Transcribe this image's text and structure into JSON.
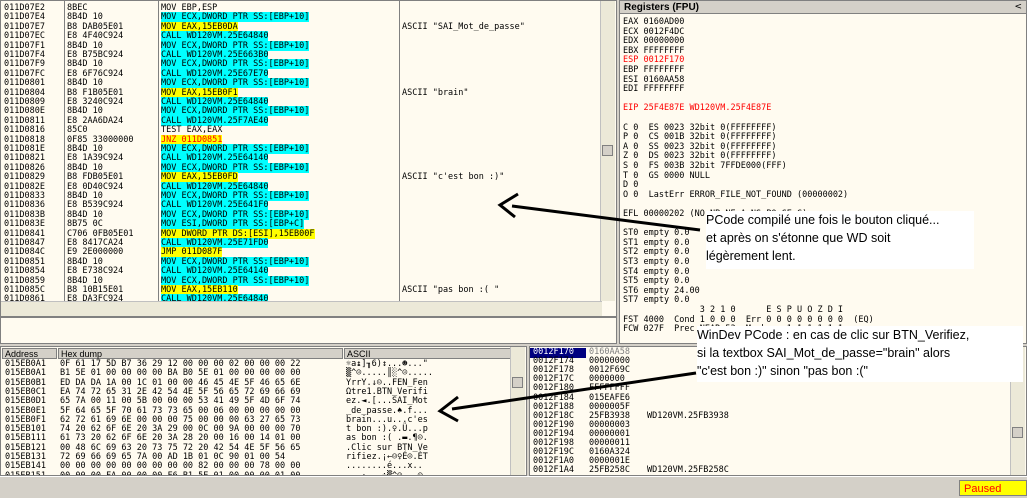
{
  "registers_title": "Registers (FPU)",
  "status": "Paused",
  "cpu_rows": [
    {
      "addr": "011D07E2",
      "hex": "8BEC",
      "ins": "MOV EBP,ESP",
      "cmt": "",
      "hl": ""
    },
    {
      "addr": "011D07E4",
      "hex": "8B4D 10",
      "ins": "MOV ECX,DWORD PTR SS:[EBP+10]",
      "cmt": "",
      "hl": "cyan"
    },
    {
      "addr": "011D07E7",
      "hex": "B8 DAB05E01",
      "ins": "MOV EAX,15EB0DA",
      "cmt": "ASCII \"SAI_Mot_de_passe\"",
      "hl": "yellow"
    },
    {
      "addr": "011D07EC",
      "hex": "E8 4F40C924",
      "ins": "CALL WD120VM.25E64840",
      "cmt": "",
      "hl": "cyan"
    },
    {
      "addr": "011D07F1",
      "hex": "8B4D 10",
      "ins": "MOV ECX,DWORD PTR SS:[EBP+10]",
      "cmt": "",
      "hl": "cyan"
    },
    {
      "addr": "011D07F4",
      "hex": "E8 B75BC924",
      "ins": "CALL WD120VM.25E663B0",
      "cmt": "",
      "hl": "cyan"
    },
    {
      "addr": "011D07F9",
      "hex": "8B4D 10",
      "ins": "MOV ECX,DWORD PTR SS:[EBP+10]",
      "cmt": "",
      "hl": "cyan"
    },
    {
      "addr": "011D07FC",
      "hex": "E8 6F76C924",
      "ins": "CALL WD120VM.25E67E70",
      "cmt": "",
      "hl": "cyan"
    },
    {
      "addr": "011D0801",
      "hex": "8B4D 10",
      "ins": "MOV ECX,DWORD PTR SS:[EBP+10]",
      "cmt": "",
      "hl": "cyan"
    },
    {
      "addr": "011D0804",
      "hex": "B8 F1B05E01",
      "ins": "MOV EAX,15EB0F1",
      "cmt": "ASCII \"brain\"",
      "hl": "yellow"
    },
    {
      "addr": "011D0809",
      "hex": "E8 3240C924",
      "ins": "CALL WD120VM.25E64840",
      "cmt": "",
      "hl": "cyan"
    },
    {
      "addr": "011D080E",
      "hex": "8B4D 10",
      "ins": "MOV ECX,DWORD PTR SS:[EBP+10]",
      "cmt": "",
      "hl": "cyan"
    },
    {
      "addr": "011D0811",
      "hex": "E8 2AA6DA24",
      "ins": "CALL WD120VM.25F7AE40",
      "cmt": "",
      "hl": "cyan"
    },
    {
      "addr": "011D0816",
      "hex": "85C0",
      "ins": "TEST EAX,EAX",
      "cmt": "",
      "hl": ""
    },
    {
      "addr": "011D0818",
      "hex": "0F85 33000000",
      "ins": "JNZ 011D0851",
      "cmt": "",
      "hl": "red"
    },
    {
      "addr": "011D081E",
      "hex": "8B4D 10",
      "ins": "MOV ECX,DWORD PTR SS:[EBP+10]",
      "cmt": "",
      "hl": "cyan"
    },
    {
      "addr": "011D0821",
      "hex": "E8 1A39C924",
      "ins": "CALL WD120VM.25E64140",
      "cmt": "",
      "hl": "cyan"
    },
    {
      "addr": "011D0826",
      "hex": "8B4D 10",
      "ins": "MOV ECX,DWORD PTR SS:[EBP+10]",
      "cmt": "",
      "hl": "cyan"
    },
    {
      "addr": "011D0829",
      "hex": "B8 FDB05E01",
      "ins": "MOV EAX,15EB0FD",
      "cmt": "ASCII \"c'est bon :)\"",
      "hl": "yellow"
    },
    {
      "addr": "011D082E",
      "hex": "E8 0D40C924",
      "ins": "CALL WD120VM.25E64840",
      "cmt": "",
      "hl": "cyan"
    },
    {
      "addr": "011D0833",
      "hex": "8B4D 10",
      "ins": "MOV ECX,DWORD PTR SS:[EBP+10]",
      "cmt": "",
      "hl": "cyan"
    },
    {
      "addr": "011D0836",
      "hex": "E8 B539C924",
      "ins": "CALL WD120VM.25E641F0",
      "cmt": "",
      "hl": "cyan"
    },
    {
      "addr": "011D083B",
      "hex": "8B4D 10",
      "ins": "MOV ECX,DWORD PTR SS:[EBP+10]",
      "cmt": "",
      "hl": "cyan"
    },
    {
      "addr": "011D083E",
      "hex": "8B75 0C",
      "ins": "MOV ESI,DWORD PTR SS:[EBP+C]",
      "cmt": "",
      "hl": "cyan"
    },
    {
      "addr": "011D0841",
      "hex": "C706 0FB05E01",
      "ins": "MOV DWORD PTR DS:[ESI],15EB00F",
      "cmt": "",
      "hl": "yellow"
    },
    {
      "addr": "011D0847",
      "hex": "E8 8417CA24",
      "ins": "CALL WD120VM.25E71FD0",
      "cmt": "",
      "hl": "cyan"
    },
    {
      "addr": "011D084C",
      "hex": "E9 2E000000",
      "ins": "JMP 011D087F",
      "cmt": "",
      "hl": "yellow"
    },
    {
      "addr": "011D0851",
      "hex": "8B4D 10",
      "ins": "MOV ECX,DWORD PTR SS:[EBP+10]",
      "cmt": "",
      "hl": "cyan"
    },
    {
      "addr": "011D0854",
      "hex": "E8 E738C924",
      "ins": "CALL WD120VM.25E64140",
      "cmt": "",
      "hl": "cyan"
    },
    {
      "addr": "011D0859",
      "hex": "8B4D 10",
      "ins": "MOV ECX,DWORD PTR SS:[EBP+10]",
      "cmt": "",
      "hl": "cyan"
    },
    {
      "addr": "011D085C",
      "hex": "B8 10B15E01",
      "ins": "MOV EAX,15EB110",
      "cmt": "ASCII \"pas bon :( \"",
      "hl": "yellow"
    },
    {
      "addr": "011D0861",
      "hex": "E8 DA3FC924",
      "ins": "CALL WD120VM.25E64840",
      "cmt": "",
      "hl": "cyan"
    },
    {
      "addr": "011D0866",
      "hex": "8B4D 10",
      "ins": "MOV ECX,DWORD PTR SS:[EBP+10]",
      "cmt": "",
      "hl": "cyan"
    },
    {
      "addr": "011D0869",
      "hex": "E8 3339C924",
      "ins": "CALL WD120VM.25E641F0",
      "cmt": "",
      "hl": "cyan"
    }
  ],
  "registers": [
    {
      "t": "EAX 0160AD00",
      "c": ""
    },
    {
      "t": "ECX 0012F4DC",
      "c": ""
    },
    {
      "t": "EDX 00000000",
      "c": ""
    },
    {
      "t": "EBX FFFFFFFF",
      "c": ""
    },
    {
      "t": "ESP 0012F170",
      "c": "red"
    },
    {
      "t": "EBP FFFFFFFF",
      "c": ""
    },
    {
      "t": "ESI 0160AA58",
      "c": ""
    },
    {
      "t": "EDI FFFFFFFF",
      "c": ""
    },
    {
      "t": "",
      "c": ""
    },
    {
      "t": "EIP 25F4E87E WD120VM.25F4E87E",
      "c": "red"
    },
    {
      "t": "",
      "c": ""
    },
    {
      "t": "C 0  ES 0023 32bit 0(FFFFFFFF)",
      "c": ""
    },
    {
      "t": "P 0  CS 001B 32bit 0(FFFFFFFF)",
      "c": ""
    },
    {
      "t": "A 0  SS 0023 32bit 0(FFFFFFFF)",
      "c": ""
    },
    {
      "t": "Z 0  DS 0023 32bit 0(FFFFFFFF)",
      "c": ""
    },
    {
      "t": "S 0  FS 003B 32bit 7FFDE000(FFF)",
      "c": ""
    },
    {
      "t": "T 0  GS 0000 NULL",
      "c": ""
    },
    {
      "t": "D 0",
      "c": ""
    },
    {
      "t": "O 0  LastErr ERROR_FILE_NOT_FOUND (00000002)",
      "c": ""
    },
    {
      "t": "",
      "c": ""
    },
    {
      "t": "EFL 00000202 (NO,NB,NE,A,NS,PO,GE,G)",
      "c": ""
    },
    {
      "t": "",
      "c": ""
    },
    {
      "t": "ST0 empty 0.0",
      "c": ""
    },
    {
      "t": "ST1 empty 0.0",
      "c": ""
    },
    {
      "t": "ST2 empty 0.0",
      "c": ""
    },
    {
      "t": "ST3 empty 0.0",
      "c": ""
    },
    {
      "t": "ST4 empty 0.0",
      "c": ""
    },
    {
      "t": "ST5 empty 0.0",
      "c": ""
    },
    {
      "t": "ST6 empty 24.00",
      "c": ""
    },
    {
      "t": "ST7 empty 0.0",
      "c": ""
    },
    {
      "t": "               3 2 1 0      E S P U O Z D I",
      "c": ""
    },
    {
      "t": "FST 4000  Cond 1 0 0 0  Err 0 0 0 0 0 0 0 0  (EQ)",
      "c": ""
    },
    {
      "t": "FCW 027F  Prec NEAR,53  Mask    1 1 1 1 1 1",
      "c": ""
    }
  ],
  "dump": {
    "headers": {
      "addr": "Address",
      "hex": "Hex dump",
      "ascii": "ASCII"
    },
    "rows": [
      {
        "addr": "015EB0A1",
        "hex": "0F 61 17 5D B7 36 29 12 00 00 00 02 00 00 00 22",
        "asc": "☼a↨]╖6)↕...☻...\""
      },
      {
        "addr": "015EB0A1",
        "hex": "B1 5E 01 00 00 00 00 BA B0 5E 01 00 00 00 00 00",
        "asc": "▒^☺.....║░^☺....."
      },
      {
        "addr": "015EB0B1",
        "hex": "ED DA DA 1A 00 1C 01 00 00 46 45 4E 5F 46 65 6E",
        "asc": "ΥrrΥ.↓☺..FEN_Fen"
      },
      {
        "addr": "015EB0C1",
        "hex": "EA 74 72 65 31 2E 42 54 4E 5F 56 65 72 69 66 69",
        "asc": "Ωtre1.BTN_Verifi"
      },
      {
        "addr": "015EB0D1",
        "hex": "65 7A 00 11 00 5B 00 00 00 53 41 49 5F 4D 6F 74",
        "asc": "ez.◄.[...SAI_Mot"
      },
      {
        "addr": "015EB0E1",
        "hex": "5F 64 65 5F 70 61 73 73 65 00 06 00 00 00 00 00",
        "asc": "_de_passe.♠.f..."
      },
      {
        "addr": "015EB0F1",
        "hex": "62 72 61 69 6E 00 00 00 75 00 00 00 63 27 65 73",
        "asc": "brain...u...c'es"
      },
      {
        "addr": "015EB101",
        "hex": "74 20 62 6F 6E 20 3A 29 00 0C 00 9A 00 00 00 70",
        "asc": "t bon :).♀.Ü...p"
      },
      {
        "addr": "015EB111",
        "hex": "61 73 20 62 6F 6E 20 3A 28 20 00 16 00 14 01 00",
        "asc": "as bon :( .▬.¶☺."
      },
      {
        "addr": "015EB121",
        "hex": "00 48 6C 69 63 20 73 75 72 20 42 54 4E 5F 56 65",
        "asc": ".Clic sur BTN_Ve"
      },
      {
        "addr": "015EB131",
        "hex": "72 69 66 69 65 7A 00 AD 1B 01 0C 90 01 00 54",
        "asc": "rifiez.¡←☺♀É☺.ÈT"
      },
      {
        "addr": "015EB141",
        "hex": "00 00 00 00 00 00 00 00 00 82 00 00 00 78 00 00",
        "asc": "........é...x.."
      },
      {
        "addr": "015EB151",
        "hex": "00 00 00 FA 00 00 00 F6 B1 5E 01 00 00 00 01 00",
        "asc": "...·...÷▒^☺...☺."
      }
    ]
  },
  "stack_rows": [
    {
      "addr": "0012F170",
      "val": "0160AA58",
      "cmt": "",
      "sel": true
    },
    {
      "addr": "0012F174",
      "val": "00000000",
      "cmt": "",
      "sel": false
    },
    {
      "addr": "0012F178",
      "val": "0012F69C",
      "cmt": "",
      "sel": false
    },
    {
      "addr": "0012F17C",
      "val": "0000000",
      "cmt": "",
      "sel": false
    },
    {
      "addr": "0012F180",
      "val": "FFFFFFFF",
      "cmt": "",
      "sel": false
    },
    {
      "addr": "0012F184",
      "val": "015EAFE6",
      "cmt": "",
      "sel": false
    },
    {
      "addr": "0012F188",
      "val": "0000005F",
      "cmt": "",
      "sel": false
    },
    {
      "addr": "0012F18C",
      "val": "25FB3938",
      "cmt": "WD120VM.25FB3938",
      "sel": false
    },
    {
      "addr": "0012F190",
      "val": "00000003",
      "cmt": "",
      "sel": false
    },
    {
      "addr": "0012F194",
      "val": "00000001",
      "cmt": "",
      "sel": false
    },
    {
      "addr": "0012F198",
      "val": "00000011",
      "cmt": "",
      "sel": false
    },
    {
      "addr": "0012F19C",
      "val": "0160A324",
      "cmt": "",
      "sel": false
    },
    {
      "addr": "0012F1A0",
      "val": "0000001E",
      "cmt": "",
      "sel": false
    },
    {
      "addr": "0012F1A4",
      "val": "25FB258C",
      "cmt": "WD120VM.25FB258C",
      "sel": false
    }
  ],
  "annotations": {
    "top": "PCode compilé une fois le bouton cliqué...\net après on s'étonne que WD soit\nlégèrement lent.",
    "bottom": "WinDev PCode : en cas de clic sur BTN_Verifiez,\nsi la textbox SAI_Mot_de_passe=\"brain\" alors\n\"c'est bon :)\" sinon \"pas bon :(\""
  }
}
